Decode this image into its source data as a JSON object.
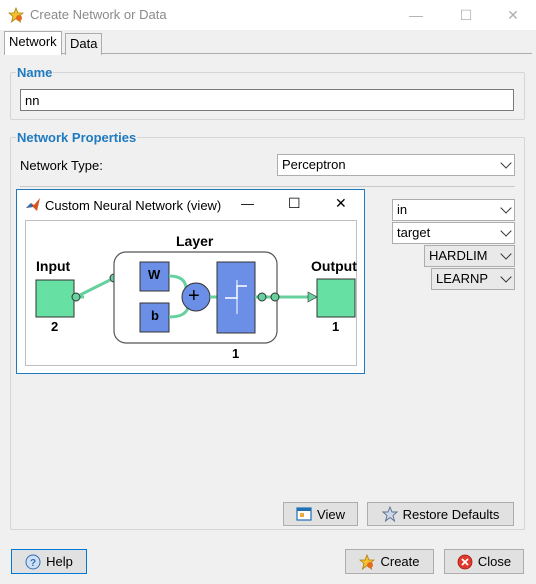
{
  "window": {
    "title": "Create Network or Data",
    "controls": [
      "—",
      "☐",
      "✕"
    ]
  },
  "tabs": [
    {
      "label": "Network",
      "active": true
    },
    {
      "label": "Data",
      "active": false
    }
  ],
  "name_section": {
    "legend": "Name",
    "value": "nn"
  },
  "properties": {
    "legend": "Network Properties",
    "type_label": "Network Type:",
    "type_value": "Perceptron",
    "input_data": "in",
    "target_data": "target",
    "transfer_function": "HARDLIM",
    "learning_function": "LEARNP"
  },
  "nn_view": {
    "title": "Custom Neural Network (view)",
    "controls": [
      "—",
      "☐",
      "✕"
    ],
    "input_label": "Input",
    "input_size": "2",
    "layer_label": "Layer",
    "weight_label": "W",
    "bias_label": "b",
    "sum_symbol": "+",
    "layer_size": "1",
    "output_label": "Output",
    "output_size": "1",
    "colors": {
      "io_box": "#66e0a3",
      "layer_block": "#6b8fe6",
      "connector": "#66d19e"
    }
  },
  "buttons": {
    "view": "View",
    "restore": "Restore Defaults",
    "help": "Help",
    "create": "Create",
    "close": "Close"
  }
}
